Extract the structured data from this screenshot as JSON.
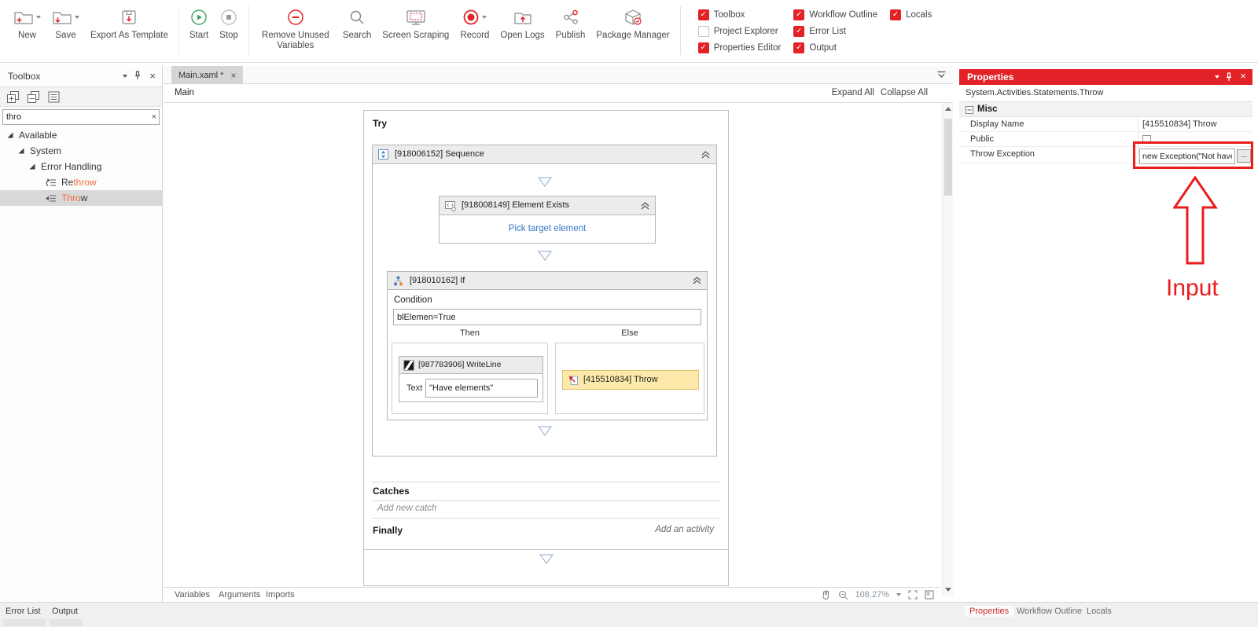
{
  "ribbon": {
    "new_label": "New",
    "save_label": "Save",
    "export_label": "Export As Template",
    "start_label": "Start",
    "stop_label": "Stop",
    "remove_unused_label": "Remove Unused Variables",
    "search_label": "Search",
    "screen_scraping_label": "Screen Scraping",
    "record_label": "Record",
    "open_logs_label": "Open Logs",
    "publish_label": "Publish",
    "package_manager_label": "Package Manager",
    "toggles": [
      {
        "label": "Toolbox",
        "checked": true
      },
      {
        "label": "Project Explorer",
        "checked": false
      },
      {
        "label": "Properties Editor",
        "checked": true
      },
      {
        "label": "Workflow Outline",
        "checked": true
      },
      {
        "label": "Error List",
        "checked": true
      },
      {
        "label": "Output",
        "checked": true
      },
      {
        "label": "Locals",
        "checked": true
      }
    ]
  },
  "toolbox": {
    "title": "Toolbox",
    "search_value": "thro",
    "tree": {
      "available": "Available",
      "system": "System",
      "error_handling": "Error Handling",
      "rethrow": {
        "pre": "Re",
        "match": "throw",
        "post": ""
      },
      "throw": {
        "pre": "",
        "match": "Thro",
        "post": "w"
      }
    }
  },
  "editor": {
    "tab_title": "Main.xaml *",
    "breadcrumb": "Main",
    "expand_all": "Expand All",
    "collapse_all": "Collapse All"
  },
  "workflow": {
    "try_label": "Try",
    "sequence_title": "[918006152] Sequence",
    "element_exists_title": "[918008149] Element Exists",
    "pick_target_link": "Pick target element",
    "if_title": "[918010162] If",
    "condition_label": "Condition",
    "condition_value": "blElemen=True",
    "then_label": "Then",
    "else_label": "Else",
    "writeline_title": "[987783906] WriteLine",
    "text_label": "Text",
    "text_value": "\"Have elements\"",
    "throw_title": "[415510834] Throw",
    "catches_label": "Catches",
    "add_new_catch": "Add new catch",
    "finally_label": "Finally",
    "add_an_activity": "Add an activity"
  },
  "designer_bar": {
    "variables": "Variables",
    "arguments": "Arguments",
    "imports": "Imports",
    "zoom_level": "108.27%"
  },
  "properties": {
    "title": "Properties",
    "type_name": "System.Activities.Statements.Throw",
    "section_label": "Misc",
    "display_name_label": "Display Name",
    "display_name_value": "[415510834] Throw",
    "public_label": "Public",
    "public_checked": false,
    "throw_exception_label": "Throw Exception",
    "throw_exception_value": "new Exception(\"Not have e",
    "ellipsis_button": "...",
    "annotation_label": "Input"
  },
  "bottom_tabs": {
    "error_list": "Error List",
    "output": "Output",
    "properties": "Properties",
    "workflow_outline": "Workflow Outline",
    "locals": "Locals"
  },
  "colors": {
    "accent_red": "#e32227",
    "match_orange": "#ed6c3c",
    "link_blue": "#3577c8",
    "throw_highlight": "#fde9a9"
  }
}
